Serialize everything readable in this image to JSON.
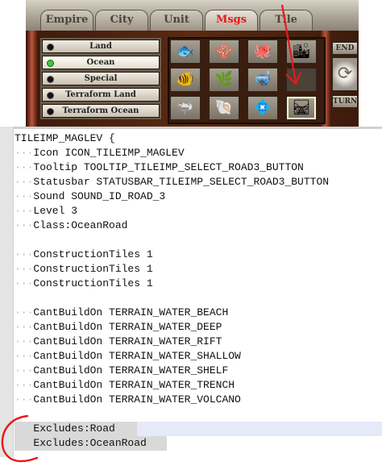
{
  "game": {
    "tabs": [
      {
        "label": "Empire",
        "active": false
      },
      {
        "label": "City",
        "active": false
      },
      {
        "label": "Unit",
        "active": false
      },
      {
        "label": "Msgs",
        "active": true
      },
      {
        "label": "Tile",
        "active": false
      }
    ],
    "categories": [
      {
        "label": "Land",
        "selected": false
      },
      {
        "label": "Ocean",
        "selected": true
      },
      {
        "label": "Special",
        "selected": false
      },
      {
        "label": "Terraform Land",
        "selected": false
      },
      {
        "label": "Terraform Ocean",
        "selected": false
      }
    ],
    "improvement_icons": [
      [
        "fish-icon",
        "reef-icon",
        "octopus-icon",
        "underwater-city-icon"
      ],
      [
        "fish-school-icon",
        "seaweed-icon",
        "diver-icon",
        "empty-slot"
      ],
      [
        "shark-icon",
        "coral-icon",
        "sea-mine-icon",
        "maglev-track-icon"
      ]
    ],
    "side_buttons": {
      "end": "END",
      "turn": "TURN"
    },
    "accent_colors": {
      "active_tab": "#e8181b",
      "selected_dot": "#3fc63f",
      "annotation_arrow": "#e8181b"
    }
  },
  "editor": {
    "lines": [
      "TILEIMP_MAGLEV {",
      "···Icon ICON_TILEIMP_MAGLEV",
      "···Tooltip TOOLTIP_TILEIMP_SELECT_ROAD3_BUTTON",
      "···Statusbar STATUSBAR_TILEIMP_SELECT_ROAD3_BUTTON",
      "···Sound SOUND_ID_ROAD_3",
      "···Level 3",
      "···Class:OceanRoad",
      "",
      "···ConstructionTiles 1",
      "···ConstructionTiles 1",
      "···ConstructionTiles 1",
      "",
      "···CantBuildOn TERRAIN_WATER_BEACH",
      "···CantBuildOn TERRAIN_WATER_DEEP",
      "···CantBuildOn TERRAIN_WATER_RIFT",
      "···CantBuildOn TERRAIN_WATER_SHALLOW",
      "···CantBuildOn TERRAIN_WATER_SHELF",
      "···CantBuildOn TERRAIN_WATER_TRENCH",
      "···CantBuildOn TERRAIN_WATER_VOLCANO",
      "",
      "   Excludes:Road",
      "   Excludes:OceanRoad"
    ],
    "highlight_colors": {
      "current_line": "#e6e9f8",
      "selection": "#d9d9d9",
      "annotation_circle": "#e8181b"
    }
  }
}
